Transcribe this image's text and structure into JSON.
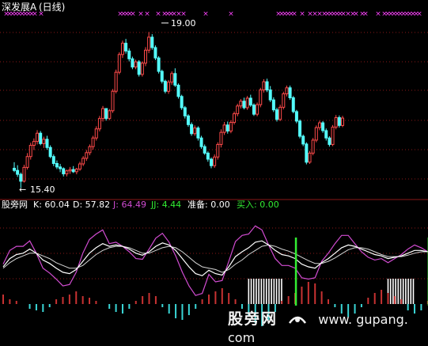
{
  "header": {
    "title": "深发展A",
    "period": "(日线)",
    "title_color": "#ffffff"
  },
  "price_annotations": {
    "high_label": "19.00",
    "low_label": "15.40"
  },
  "indicator_header": {
    "name": "股旁网",
    "k_label": "K: 60.04",
    "d_label": "D: 57.82",
    "j_label": "J: 64.49",
    "jj_label": "JJ: 4.44",
    "ready_label": "准备: 0.00",
    "buy_label": "买入: 0.00"
  },
  "watermark": {
    "text": "股旁网",
    "url": "www. gupang. com"
  },
  "colors": {
    "up": "#ff4a4a",
    "down": "#54ffff",
    "marker": "#ff44ff",
    "k_line": "#ffffff",
    "d_line": "#d4d4d4",
    "j_line": "#d24cd2",
    "buy": "#33ee33",
    "bar_up": "#c83232",
    "bar_down": "#3ad6d6",
    "grid": "#8a1818"
  },
  "chart_data": [
    {
      "type": "candlestick",
      "title": "深发展A (日线)",
      "ylim": [
        15.2,
        19.3
      ],
      "high_marker": 19.0,
      "low_marker": 15.4,
      "candles": [
        [
          15.85,
          15.99,
          15.76,
          15.8
        ],
        [
          15.8,
          15.92,
          15.65,
          15.71
        ],
        [
          15.71,
          15.75,
          15.4,
          15.55
        ],
        [
          15.55,
          15.93,
          15.52,
          15.87
        ],
        [
          15.87,
          16.2,
          15.82,
          16.12
        ],
        [
          16.12,
          16.44,
          16.05,
          16.38
        ],
        [
          16.38,
          16.54,
          16.27,
          16.47
        ],
        [
          16.47,
          16.73,
          16.4,
          16.66
        ],
        [
          16.66,
          16.71,
          16.38,
          16.42
        ],
        [
          16.42,
          16.58,
          16.32,
          16.52
        ],
        [
          16.52,
          16.6,
          16.28,
          16.33
        ],
        [
          16.33,
          16.38,
          16.08,
          16.12
        ],
        [
          16.12,
          16.17,
          15.9,
          15.96
        ],
        [
          15.96,
          16.03,
          15.83,
          15.88
        ],
        [
          15.88,
          15.95,
          15.76,
          15.84
        ],
        [
          15.84,
          15.87,
          15.66,
          15.72
        ],
        [
          15.72,
          15.82,
          15.66,
          15.79
        ],
        [
          15.79,
          15.88,
          15.72,
          15.82
        ],
        [
          15.82,
          15.9,
          15.74,
          15.77
        ],
        [
          15.77,
          15.86,
          15.71,
          15.83
        ],
        [
          15.83,
          16.0,
          15.79,
          15.95
        ],
        [
          15.95,
          16.13,
          15.9,
          16.08
        ],
        [
          16.08,
          16.27,
          16.02,
          16.21
        ],
        [
          16.21,
          16.4,
          16.15,
          16.35
        ],
        [
          16.35,
          16.6,
          16.28,
          16.55
        ],
        [
          16.55,
          16.82,
          16.49,
          16.76
        ],
        [
          16.76,
          17.06,
          16.7,
          17.0
        ],
        [
          17.0,
          17.29,
          16.93,
          17.23
        ],
        [
          17.23,
          17.23,
          16.95,
          17.0
        ],
        [
          17.0,
          17.22,
          16.96,
          17.18
        ],
        [
          17.18,
          17.68,
          17.13,
          17.63
        ],
        [
          17.63,
          18.13,
          17.58,
          18.07
        ],
        [
          18.07,
          18.53,
          18.02,
          18.48
        ],
        [
          18.48,
          18.8,
          18.4,
          18.74
        ],
        [
          18.74,
          18.84,
          18.5,
          18.56
        ],
        [
          18.56,
          18.62,
          18.32,
          18.38
        ],
        [
          18.38,
          18.43,
          18.14,
          18.19
        ],
        [
          18.19,
          18.36,
          18.14,
          18.31
        ],
        [
          18.31,
          18.35,
          17.97,
          18.02
        ],
        [
          18.02,
          18.32,
          17.97,
          18.28
        ],
        [
          18.28,
          18.65,
          18.21,
          18.58
        ],
        [
          18.58,
          19.0,
          18.51,
          18.88
        ],
        [
          18.88,
          18.95,
          18.59,
          18.64
        ],
        [
          18.64,
          18.69,
          18.35,
          18.4
        ],
        [
          18.4,
          18.44,
          18.04,
          18.09
        ],
        [
          18.09,
          18.13,
          17.81,
          17.86
        ],
        [
          17.86,
          17.9,
          17.58,
          17.63
        ],
        [
          17.63,
          17.89,
          17.57,
          17.84
        ],
        [
          17.84,
          18.09,
          17.78,
          18.04
        ],
        [
          18.04,
          18.16,
          17.73,
          17.77
        ],
        [
          17.77,
          17.81,
          17.46,
          17.51
        ],
        [
          17.51,
          17.55,
          17.2,
          17.25
        ],
        [
          17.25,
          17.29,
          17.0,
          17.06
        ],
        [
          17.06,
          17.1,
          16.81,
          16.86
        ],
        [
          16.86,
          16.91,
          16.6,
          16.65
        ],
        [
          16.65,
          16.84,
          16.6,
          16.78
        ],
        [
          16.78,
          16.82,
          16.49,
          16.55
        ],
        [
          16.55,
          16.6,
          16.3,
          16.35
        ],
        [
          16.35,
          16.4,
          16.16,
          16.2
        ],
        [
          16.2,
          16.24,
          16.0,
          16.06
        ],
        [
          16.06,
          16.1,
          15.85,
          15.91
        ],
        [
          15.91,
          16.17,
          15.86,
          16.11
        ],
        [
          16.11,
          16.45,
          16.05,
          16.4
        ],
        [
          16.4,
          16.75,
          16.33,
          16.68
        ],
        [
          16.68,
          16.92,
          16.62,
          16.85
        ],
        [
          16.85,
          16.93,
          16.65,
          16.71
        ],
        [
          16.71,
          16.96,
          16.66,
          16.91
        ],
        [
          16.91,
          17.16,
          16.86,
          17.11
        ],
        [
          17.11,
          17.34,
          17.05,
          17.29
        ],
        [
          17.29,
          17.45,
          17.23,
          17.4
        ],
        [
          17.4,
          17.48,
          17.21,
          17.25
        ],
        [
          17.25,
          17.52,
          17.2,
          17.47
        ],
        [
          17.47,
          17.55,
          17.27,
          17.31
        ],
        [
          17.31,
          17.35,
          17.06,
          17.1
        ],
        [
          17.1,
          17.37,
          17.05,
          17.32
        ],
        [
          17.32,
          17.71,
          17.26,
          17.66
        ],
        [
          17.66,
          17.91,
          17.6,
          17.85
        ],
        [
          17.85,
          17.92,
          17.61,
          17.66
        ],
        [
          17.66,
          17.75,
          17.38,
          17.43
        ],
        [
          17.43,
          17.49,
          17.15,
          17.2
        ],
        [
          17.2,
          17.25,
          16.93,
          16.98
        ],
        [
          16.98,
          17.32,
          16.94,
          17.26
        ],
        [
          17.26,
          17.62,
          17.21,
          17.57
        ],
        [
          17.57,
          17.76,
          17.51,
          17.71
        ],
        [
          17.71,
          17.76,
          17.43,
          17.48
        ],
        [
          17.48,
          17.52,
          17.12,
          17.16
        ],
        [
          17.16,
          17.2,
          16.89,
          16.94
        ],
        [
          16.94,
          16.98,
          16.54,
          16.59
        ],
        [
          16.59,
          16.63,
          16.36,
          16.41
        ],
        [
          16.41,
          16.45,
          15.94,
          15.99
        ],
        [
          15.99,
          16.25,
          15.95,
          16.2
        ],
        [
          16.2,
          16.55,
          16.15,
          16.5
        ],
        [
          16.5,
          16.84,
          16.45,
          16.79
        ],
        [
          16.79,
          16.95,
          16.73,
          16.9
        ],
        [
          16.9,
          16.94,
          16.67,
          16.72
        ],
        [
          16.72,
          16.77,
          16.49,
          16.55
        ],
        [
          16.55,
          16.59,
          16.35,
          16.4
        ],
        [
          16.4,
          16.85,
          16.36,
          16.8
        ],
        [
          16.8,
          17.08,
          16.75,
          17.02
        ],
        [
          17.02,
          17.07,
          16.79,
          16.84
        ],
        [
          16.84,
          17.06,
          16.8,
          17.01
        ]
      ]
    },
    {
      "type": "line",
      "title": "股旁网",
      "ylim": [
        -40,
        120
      ],
      "series_names": [
        "K",
        "D",
        "J",
        "JJ",
        "准备",
        "买入"
      ],
      "k": [
        40,
        52,
        58,
        60,
        66,
        60,
        50,
        45,
        38,
        32,
        30,
        36,
        48,
        60,
        68,
        74,
        70,
        72,
        70,
        66,
        60,
        57,
        62,
        70,
        75,
        72,
        64,
        52,
        40,
        30,
        27,
        35,
        30,
        28,
        40,
        55,
        62,
        68,
        76,
        78,
        72,
        64,
        58,
        56,
        52,
        44,
        40,
        38,
        46,
        52,
        60,
        68,
        72,
        70,
        66,
        62,
        58,
        56,
        52,
        54,
        56,
        60,
        64,
        64,
        62
      ],
      "d": [
        38,
        46,
        52,
        56,
        60,
        60,
        56,
        52,
        46,
        42,
        38,
        38,
        42,
        50,
        58,
        64,
        68,
        70,
        70,
        68,
        64,
        60,
        60,
        64,
        68,
        70,
        68,
        62,
        54,
        46,
        40,
        38,
        36,
        32,
        36,
        44,
        50,
        58,
        64,
        70,
        72,
        70,
        66,
        63,
        59,
        54,
        49,
        45,
        45,
        48,
        53,
        59,
        65,
        68,
        68,
        66,
        62,
        58,
        55,
        55,
        55,
        57,
        60,
        62,
        62
      ],
      "j": [
        44,
        64,
        70,
        70,
        78,
        60,
        38,
        31,
        22,
        12,
        14,
        32,
        60,
        80,
        88,
        94,
        74,
        76,
        70,
        62,
        52,
        51,
        66,
        82,
        89,
        76,
        56,
        32,
        12,
        -2,
        1,
        29,
        18,
        20,
        48,
        77,
        86,
        88,
        100,
        94,
        72,
        52,
        42,
        42,
        38,
        24,
        22,
        24,
        48,
        60,
        74,
        86,
        86,
        74,
        62,
        54,
        50,
        52,
        46,
        52,
        58,
        66,
        72,
        68,
        62
      ],
      "jj_values": [
        4.44
      ],
      "buy_signal_indices": [
        44,
        64
      ],
      "ready_zone_index_ranges": [
        [
          37,
          42
        ],
        [
          58,
          62
        ]
      ],
      "histogram": [
        12,
        6,
        4,
        0,
        -6,
        -8,
        -10,
        -4,
        6,
        9,
        12,
        16,
        10,
        8,
        4,
        0,
        -6,
        -10,
        -12,
        -6,
        4,
        10,
        14,
        10,
        -4,
        -12,
        -18,
        -20,
        -14,
        -6,
        6,
        12,
        16,
        20,
        14,
        6,
        -6,
        -16,
        -24,
        -28,
        -20,
        -10,
        4,
        10,
        14,
        22,
        28,
        26,
        16,
        6,
        -4,
        -12,
        -16,
        -12,
        -4,
        8,
        14,
        18,
        14,
        10,
        6,
        -8,
        -12,
        -8,
        4
      ]
    }
  ]
}
